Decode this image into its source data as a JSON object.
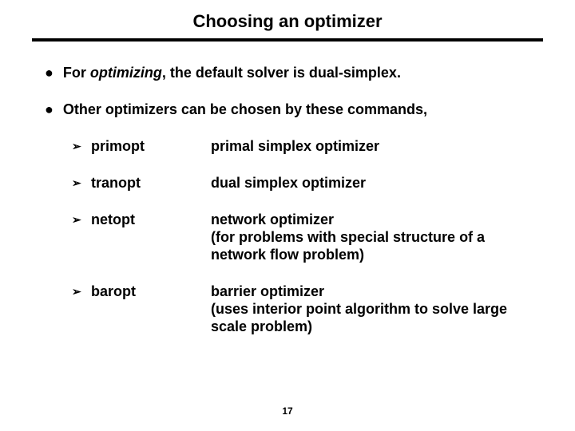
{
  "title": "Choosing an optimizer",
  "bullet1_pre": "For ",
  "bullet1_em": "optimizing",
  "bullet1_post": ", the default solver is dual-simplex.",
  "bullet2": "Other optimizers can be chosen by these commands,",
  "items": [
    {
      "cmd": "primopt",
      "desc": "primal simplex optimizer"
    },
    {
      "cmd": "tranopt",
      "desc": "dual simplex optimizer"
    },
    {
      "cmd": "netopt",
      "desc": "network optimizer\n(for problems with special structure of a network flow problem)"
    },
    {
      "cmd": "baropt",
      "desc": "barrier optimizer\n(uses interior point algorithm to solve large scale problem)"
    }
  ],
  "page_number": "17",
  "glyphs": {
    "bullet": "●",
    "arrow": "➢"
  }
}
